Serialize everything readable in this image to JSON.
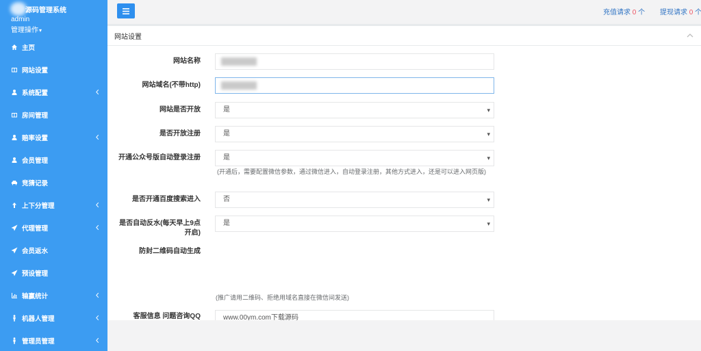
{
  "sidebar": {
    "brand": "源码管理系统",
    "user": "admin",
    "user_menu": "管理操作",
    "items": [
      {
        "label": "主页",
        "icon": "home-icon"
      },
      {
        "label": "网站设置",
        "icon": "columns-icon"
      },
      {
        "label": "系统配置",
        "icon": "user-icon",
        "has_submenu": true
      },
      {
        "label": "房间管理",
        "icon": "columns-icon"
      },
      {
        "label": "赔率设置",
        "icon": "user-icon",
        "has_submenu": true
      },
      {
        "label": "会员管理",
        "icon": "user-icon"
      },
      {
        "label": "竞猜记录",
        "icon": "car-icon"
      },
      {
        "label": "上下分管理",
        "icon": "level-up-icon",
        "has_submenu": true
      },
      {
        "label": "代理管理",
        "icon": "send-icon",
        "has_submenu": true
      },
      {
        "label": "会员返水",
        "icon": "send-icon"
      },
      {
        "label": "预设管理",
        "icon": "send-icon"
      },
      {
        "label": "输赢统计",
        "icon": "bar-chart-icon",
        "has_submenu": true
      },
      {
        "label": "机器人管理",
        "icon": "male-icon",
        "has_submenu": true
      },
      {
        "label": "管理员管理",
        "icon": "male-icon",
        "has_submenu": true
      }
    ]
  },
  "topbar": {
    "recharge": {
      "label": "充值请求",
      "count": "0",
      "unit": "个"
    },
    "withdraw": {
      "label": "提现请求",
      "count": "0",
      "unit": "个"
    }
  },
  "panel": {
    "title": "网站设置"
  },
  "form": {
    "site_name": {
      "label": "网站名称"
    },
    "site_domain": {
      "label": "网站域名(不带http)"
    },
    "site_open": {
      "label": "网站是否开放",
      "value": "是"
    },
    "registration_open": {
      "label": "是否开放注册",
      "value": "是"
    },
    "wechat_auto_login": {
      "label": "开通公众号版自动登录注册",
      "value": "是",
      "help": "(开通后，需要配置微信参数，通过微信进入，自动登录注册，其他方式进入，还是可以进入网页版)"
    },
    "baidu_search": {
      "label": "是否开通百度搜索进入",
      "value": "否"
    },
    "auto_rebate": {
      "label": "是否自动反水(每天早上9点开启)",
      "value": "是"
    },
    "anti_block_qr": {
      "label": "防封二维码自动生成",
      "help": "(推广请用二维码、拒绝用域名直接在微信间发送)"
    },
    "customer_service": {
      "label": "客服信息 问题咨询QQ",
      "value": "www.00ym.com下载源码"
    }
  },
  "colors": {
    "sidebar_bg": "#3c9cf2",
    "button_bg": "#2e8fee",
    "count_red": "#ed5565",
    "link_blue": "#3275c4"
  }
}
